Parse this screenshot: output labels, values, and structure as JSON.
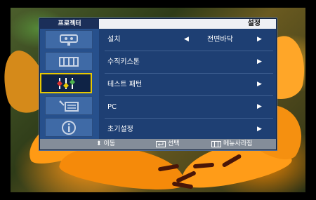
{
  "header": {
    "tab": "프로젝터",
    "title": "설정"
  },
  "sidebar": {
    "icons": [
      {
        "name": "image-settings-icon",
        "selected": false
      },
      {
        "name": "screen-settings-icon",
        "selected": false
      },
      {
        "name": "setup-sliders-icon",
        "selected": true
      },
      {
        "name": "advanced-tools-icon",
        "selected": false
      },
      {
        "name": "information-icon",
        "selected": false
      }
    ]
  },
  "menu": {
    "items": [
      {
        "label": "설치",
        "value": "전면바닥"
      },
      {
        "label": "수직키스톤"
      },
      {
        "label": "테스트 패턴"
      },
      {
        "label": "PC"
      },
      {
        "label": "초기설정"
      }
    ]
  },
  "footer": {
    "move": "이동",
    "select": "선택",
    "menu_exit": "메뉴사라짐"
  },
  "colors": {
    "panel": "#1e3f73",
    "highlight": "#e8c800",
    "footer": "#848d99"
  }
}
